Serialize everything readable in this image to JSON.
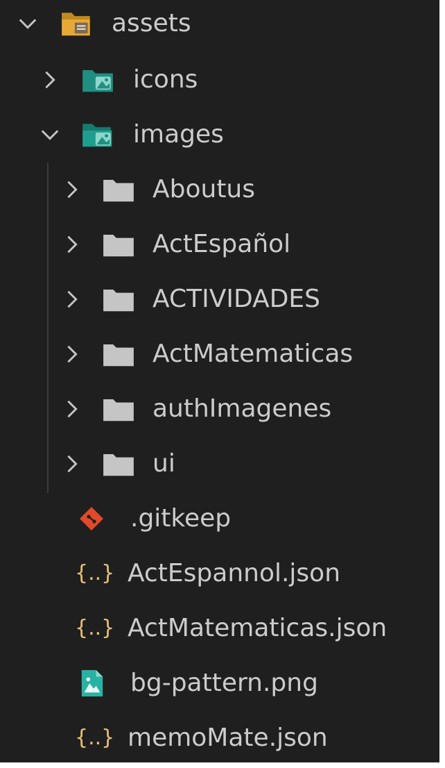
{
  "colors": {
    "background": "#1f1f1f",
    "text": "#cccccc",
    "folder_grey": "#c5c5c5",
    "folder_assets": "#e8a835",
    "folder_teal": "#1f9e8f",
    "json_yellow": "#e5c07b",
    "git_red": "#e0492a",
    "image_teal": "#28b2a4"
  },
  "tree": {
    "assets": {
      "label": "assets",
      "chevron": "chevron-down-icon",
      "icon": "folder-open-icon"
    },
    "icons": {
      "label": "icons",
      "chevron": "chevron-right-icon",
      "icon": "image-folder-icon"
    },
    "images": {
      "label": "images",
      "chevron": "chevron-down-icon",
      "icon": "image-folder-open-icon"
    },
    "folders": [
      {
        "label": "Aboutus",
        "chevron": "chevron-right-icon",
        "icon": "folder-icon"
      },
      {
        "label": "ActEspañol",
        "chevron": "chevron-right-icon",
        "icon": "folder-icon"
      },
      {
        "label": "ACTIVIDADES",
        "chevron": "chevron-right-icon",
        "icon": "folder-icon"
      },
      {
        "label": "ActMatematicas",
        "chevron": "chevron-right-icon",
        "icon": "folder-icon"
      },
      {
        "label": "authImagenes",
        "chevron": "chevron-right-icon",
        "icon": "folder-icon"
      },
      {
        "label": "ui",
        "chevron": "chevron-right-icon",
        "icon": "folder-icon"
      }
    ],
    "files": [
      {
        "label": ".gitkeep",
        "icon": "git-icon"
      },
      {
        "label": "ActEspannol.json",
        "icon": "json-icon"
      },
      {
        "label": "ActMatematicas.json",
        "icon": "json-icon"
      },
      {
        "label": "bg-pattern.png",
        "icon": "image-file-icon"
      },
      {
        "label": "memoMate.json",
        "icon": "json-icon"
      }
    ]
  }
}
